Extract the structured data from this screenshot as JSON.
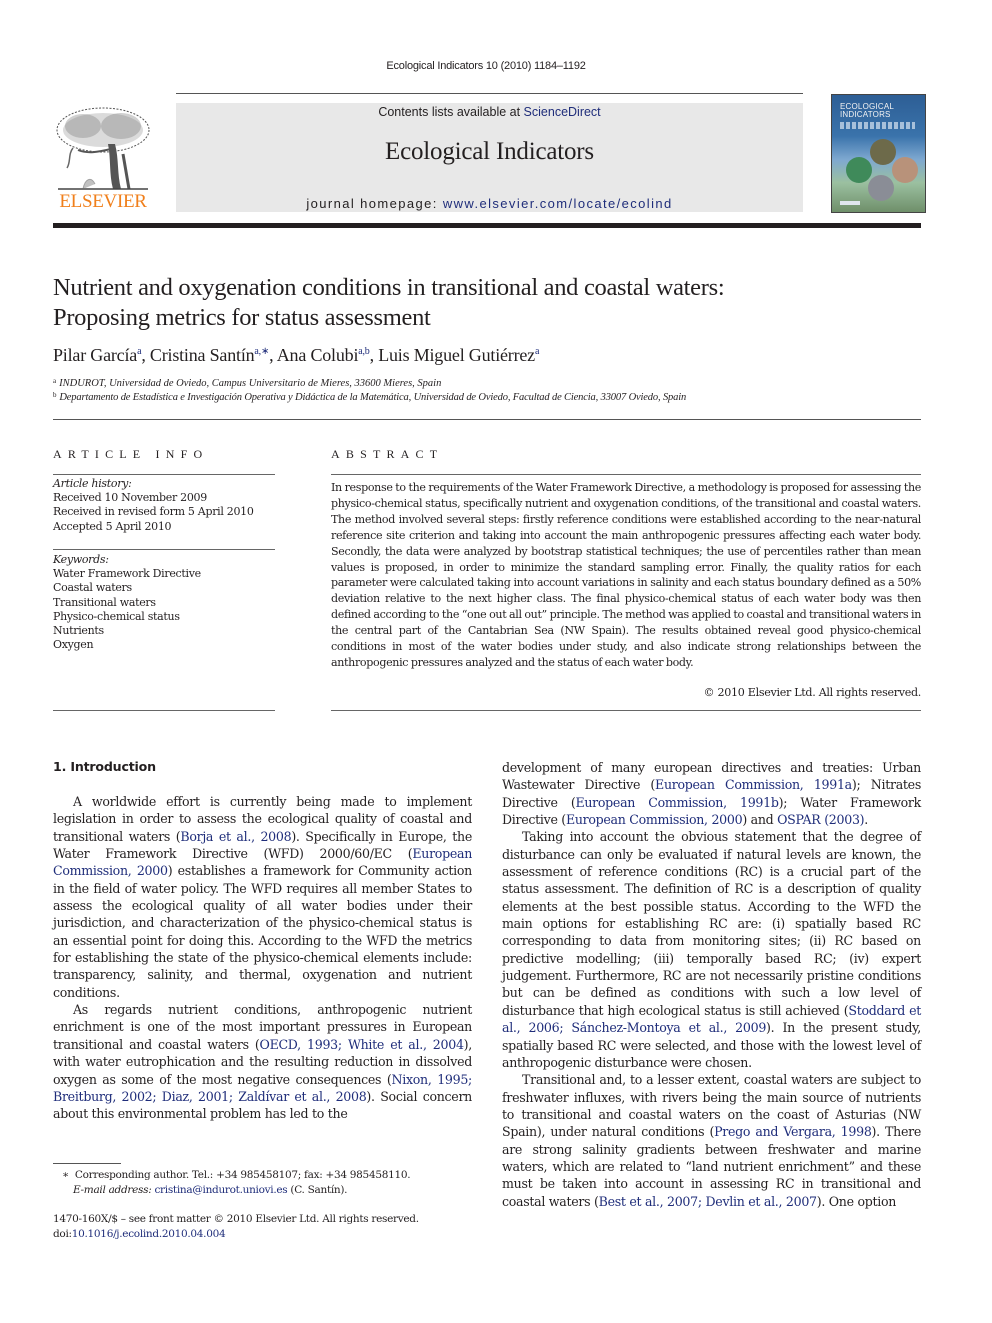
{
  "header": {
    "journal_ref": "Ecological Indicators 10 (2010) 1184–1192",
    "contents_prefix": "Contents lists available at ",
    "contents_link": "ScienceDirect",
    "journal_title": "Ecological Indicators",
    "homepage_prefix": "journal homepage: ",
    "homepage_link": "www.elsevier.com/locate/ecolind",
    "publisher_logo_text": "ELSEVIER",
    "publisher_logo_icon": "tree-logo-icon",
    "cover_title_line1": "ECOLOGICAL",
    "cover_title_line2": "INDICATORS",
    "colors": {
      "elsevier_orange": "#f07f1b",
      "link_blue": "#1f2d7a",
      "banner_gray": "#e8e8e8"
    }
  },
  "article": {
    "title_line1": "Nutrient and oxygenation conditions in transitional and coastal waters:",
    "title_line2": "Proposing metrics for status assessment",
    "authors": [
      {
        "name": "Pilar García",
        "sup": "a"
      },
      {
        "name": "Cristina Santín",
        "sup": "a,∗"
      },
      {
        "name": "Ana Colubi",
        "sup": "a,b"
      },
      {
        "name": "Luis Miguel Gutiérrez",
        "sup": "a"
      }
    ],
    "affiliations": [
      {
        "key": "a",
        "text": "INDUROT, Universidad de Oviedo, Campus Universitario de Mieres, 33600 Mieres, Spain"
      },
      {
        "key": "b",
        "text": "Departamento de Estadística e Investigación Operativa y Didáctica de la Matemática, Universidad de Oviedo, Facultad de Ciencia, 33007 Oviedo, Spain"
      }
    ]
  },
  "article_info": {
    "label": "ARTICLE INFO",
    "history_label": "Article history:",
    "history": [
      "Received 10 November 2009",
      "Received in revised form 5 April 2010",
      "Accepted 5 April 2010"
    ],
    "keywords_label": "Keywords:",
    "keywords": [
      "Water Framework Directive",
      "Coastal waters",
      "Transitional waters",
      "Physico-chemical status",
      "Nutrients",
      "Oxygen"
    ]
  },
  "abstract": {
    "label": "ABSTRACT",
    "text": "In response to the requirements of the Water Framework Directive, a methodology is proposed for assessing the physico-chemical status, specifically nutrient and oxygenation conditions, of the transitional and coastal waters. The method involved several steps: firstly reference conditions were established according to the near-natural reference site criterion and taking into account the main anthropogenic pressures affecting each water body. Secondly, the data were analyzed by bootstrap statistical techniques; the use of percentiles rather than mean values is proposed, in order to minimize the standard sampling error. Finally, the quality ratios for each parameter were calculated taking into account variations in salinity and each status boundary defined as a 50% deviation relative to the next higher class. The final physico-chemical status of each water body was then defined according to the “one out all out” principle. The method was applied to coastal and transitional waters in the central part of the Cantabrian Sea (NW Spain). The results obtained reveal good physico-chemical conditions in most of the water bodies under study, and also indicate strong relationships between the anthropogenic pressures analyzed and the status of each water body.",
    "copyright": "© 2010 Elsevier Ltd. All rights reserved."
  },
  "body": {
    "section_heading": "1.  Introduction",
    "left_paragraphs": [
      [
        {
          "t": "A worldwide effort is currently being made to implement legislation in order to assess the ecological quality of coastal and transitional waters ("
        },
        {
          "t": "Borja et al., 2008",
          "link": true
        },
        {
          "t": "). Specifically in Europe, the Water Framework Directive (WFD) 2000/60/EC ("
        },
        {
          "t": "European Commission, 2000",
          "link": true
        },
        {
          "t": ") establishes a framework for Community action in the field of water policy. The WFD requires all member States to assess the ecological quality of all water bodies under their jurisdiction, and characterization of the physico-chemical status is an essential point for doing this. According to the WFD the metrics for establishing the state of the physico-chemical elements include: transparency, salinity, and thermal, oxygenation and nutrient conditions."
        }
      ],
      [
        {
          "t": "As regards nutrient conditions, anthropogenic nutrient enrichment is one of the most important pressures in European transitional and coastal waters ("
        },
        {
          "t": "OECD, 1993; White et al., 2004",
          "link": true
        },
        {
          "t": "), with water eutrophication and the resulting reduction in dissolved oxygen as some of the most negative consequences ("
        },
        {
          "t": "Nixon, 1995; Breitburg, 2002; Diaz, 2001; Zaldívar et al., 2008",
          "link": true
        },
        {
          "t": "). Social concern about this environmental problem has led to the"
        }
      ]
    ],
    "right_paragraphs": [
      [
        {
          "t": "development of many european directives and treaties: Urban Wastewater Directive ("
        },
        {
          "t": "European Commission, 1991a",
          "link": true
        },
        {
          "t": "); Nitrates Directive ("
        },
        {
          "t": "European Commission, 1991b",
          "link": true
        },
        {
          "t": "); Water Framework Directive ("
        },
        {
          "t": "European Commission, 2000",
          "link": true
        },
        {
          "t": ") and "
        },
        {
          "t": "OSPAR (2003)",
          "link": true
        },
        {
          "t": "."
        }
      ],
      [
        {
          "t": "Taking into account the obvious statement that the degree of disturbance can only be evaluated if natural levels are known, the assessment of reference conditions (RC) is a crucial part of the status assessment. The definition of RC is a description of quality elements at the best possible status. According to the WFD the main options for establishing RC are: (i) spatially based RC corresponding to data from monitoring sites; (ii) RC based on predictive modelling; (iii) temporally based RC; (iv) expert judgement. Furthermore, RC are not necessarily pristine conditions but can be defined as conditions with such a low level of disturbance that high ecological status is still achieved ("
        },
        {
          "t": "Stoddard et al., 2006; Sánchez-Montoya et al., 2009",
          "link": true
        },
        {
          "t": "). In the present study, spatially based RC were selected, and those with the lowest level of anthropogenic disturbance were chosen."
        }
      ],
      [
        {
          "t": "Transitional and, to a lesser extent, coastal waters are subject to freshwater influxes, with rivers being the main source of nutrients to transitional and coastal waters on the coast of Asturias (NW Spain), under natural conditions ("
        },
        {
          "t": "Prego and Vergara, 1998",
          "link": true
        },
        {
          "t": "). There are strong salinity gradients between freshwater and marine waters, which are related to “land nutrient enrichment” and these must be taken into account in assessing RC in transitional and coastal waters ("
        },
        {
          "t": "Best et al., 2007; Devlin et al., 2007",
          "link": true
        },
        {
          "t": "). One option"
        }
      ]
    ]
  },
  "footnote": {
    "marker": "∗",
    "corresponding": "Corresponding author. Tel.: +34 985458107; fax: +34 985458110.",
    "email_label": "E-mail address: ",
    "email": "cristina@indurot.uniovi.es",
    "email_suffix": " (C. Santín)."
  },
  "front_matter": {
    "issn_line": "1470-160X/$ – see front matter © 2010 Elsevier Ltd. All rights reserved.",
    "doi_prefix": "doi:",
    "doi": "10.1016/j.ecolind.2010.04.004"
  }
}
